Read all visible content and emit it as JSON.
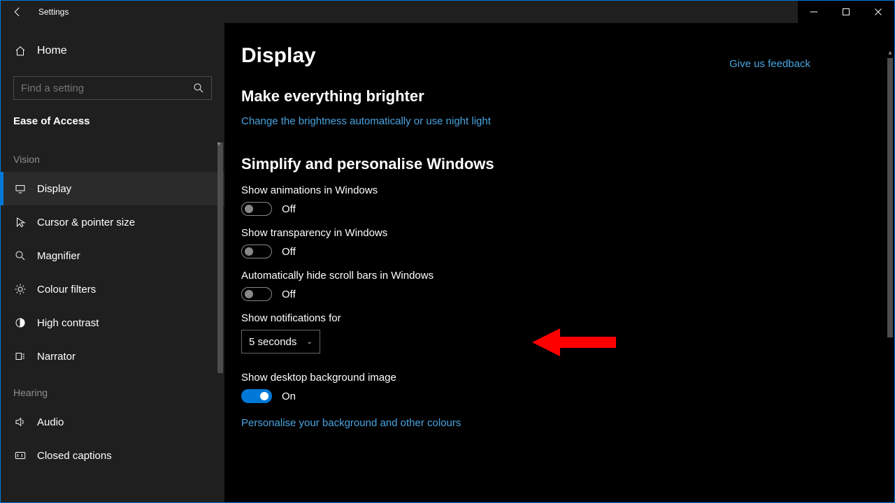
{
  "titlebar": {
    "title": "Settings"
  },
  "sidebar": {
    "home": "Home",
    "search_placeholder": "Find a setting",
    "section": "Ease of Access",
    "groups": [
      {
        "label": "Vision",
        "items": [
          {
            "id": "display",
            "label": "Display",
            "active": true
          },
          {
            "id": "cursor",
            "label": "Cursor & pointer size"
          },
          {
            "id": "magnifier",
            "label": "Magnifier"
          },
          {
            "id": "colourfilters",
            "label": "Colour filters"
          },
          {
            "id": "highcontrast",
            "label": "High contrast"
          },
          {
            "id": "narrator",
            "label": "Narrator"
          }
        ]
      },
      {
        "label": "Hearing",
        "items": [
          {
            "id": "audio",
            "label": "Audio"
          },
          {
            "id": "closedcaptions",
            "label": "Closed captions"
          }
        ]
      }
    ]
  },
  "content": {
    "title": "Display",
    "feedback": "Give us feedback",
    "section_brighter": {
      "heading": "Make everything brighter",
      "link": "Change the brightness automatically or use night light"
    },
    "section_simplify": {
      "heading": "Simplify and personalise Windows",
      "animations": {
        "label": "Show animations in Windows",
        "state": "Off",
        "on": false
      },
      "transparency": {
        "label": "Show transparency in Windows",
        "state": "Off",
        "on": false
      },
      "hide_scroll": {
        "label": "Automatically hide scroll bars in Windows",
        "state": "Off",
        "on": false
      },
      "notifications": {
        "label": "Show notifications for",
        "value": "5 seconds"
      },
      "desktop_bg": {
        "label": "Show desktop background image",
        "state": "On",
        "on": true
      },
      "personalise_link": "Personalise your background and other colours"
    }
  }
}
